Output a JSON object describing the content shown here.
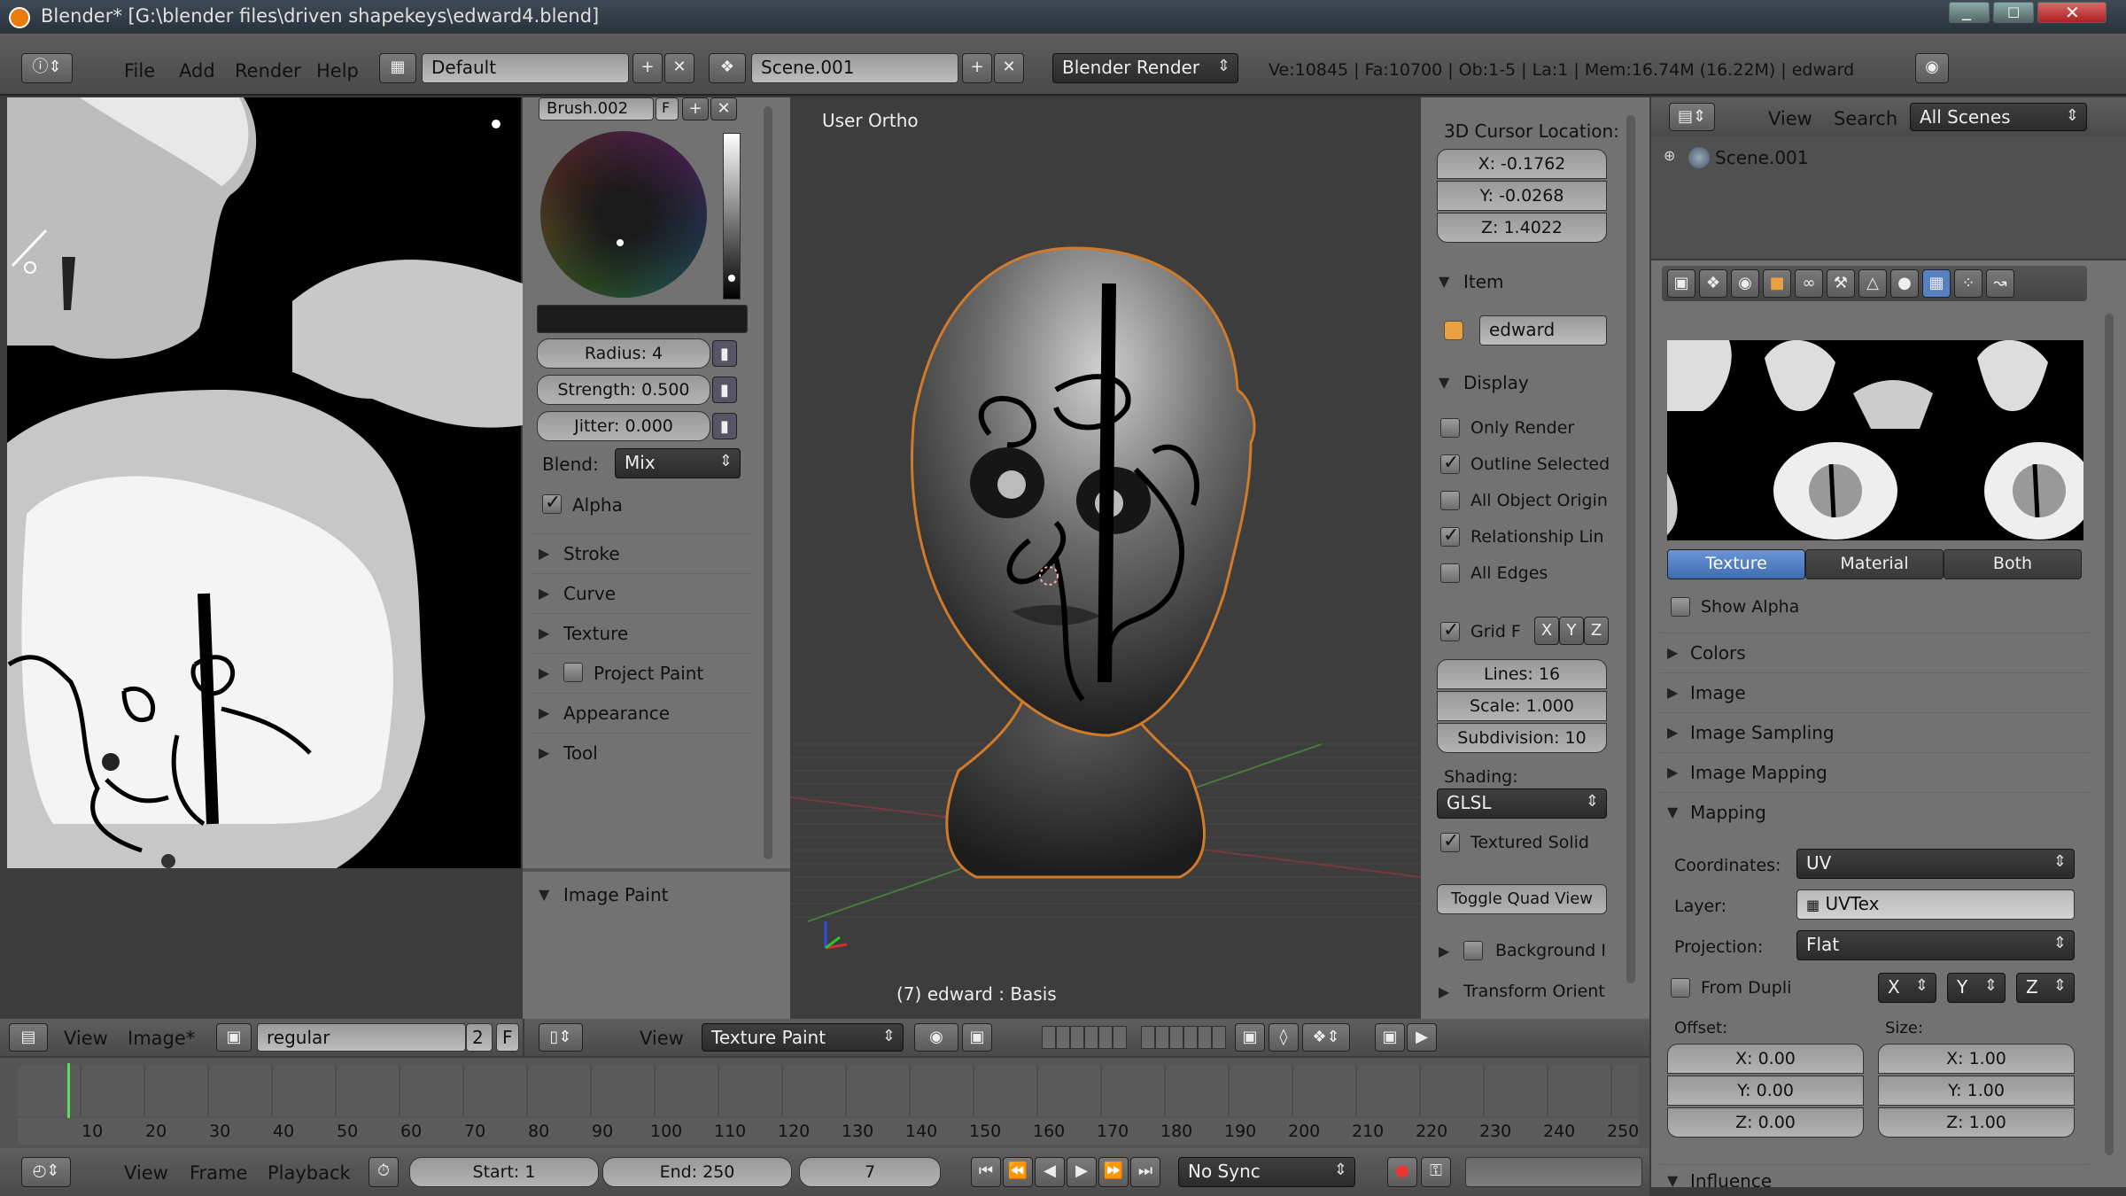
{
  "window": {
    "title": "Blender* [G:\\blender files\\driven shapekeys\\edward4.blend]"
  },
  "info_header": {
    "menus": [
      "File",
      "Add",
      "Render",
      "Help"
    ],
    "screen_layout": "Default",
    "scene": "Scene.001",
    "render_engine": "Blender Render",
    "stats": "Ve:10845 | Fa:10700 | Ob:1-5 | La:1 | Mem:16.74M (16.22M) | edward"
  },
  "image_editor": {
    "menus": [
      "View",
      "Image*"
    ],
    "image_name": "regular",
    "users": "2",
    "pin": "F"
  },
  "brush_panel": {
    "brush_name": "Brush.002",
    "brush_users": "F",
    "radius": "Radius: 4",
    "strength": "Strength: 0.500",
    "jitter": "Jitter: 0.000",
    "blend_label": "Blend:",
    "blend_value": "Mix",
    "alpha_label": "Alpha",
    "sections": [
      "Stroke",
      "Curve",
      "Texture",
      "Project Paint",
      "Appearance",
      "Tool"
    ],
    "image_paint": "Image Paint"
  },
  "viewport": {
    "view_label": "User Ortho",
    "object_label": "(7) edward : Basis",
    "header_menus": [
      "View"
    ],
    "mode": "Texture Paint"
  },
  "n_panel": {
    "cursor_title": "3D Cursor Location:",
    "cursor_x": "X: -0.1762",
    "cursor_y": "Y: -0.0268",
    "cursor_z": "Z: 1.4022",
    "item_title": "Item",
    "item_name": "edward",
    "display_title": "Display",
    "only_render": "Only Render",
    "outline_selected": "Outline Selected",
    "all_object_origin": "All Object Origin",
    "relationship_lines": "Relationship Lin",
    "all_edges": "All Edges",
    "grid_floor": "Grid F",
    "grid_axes": [
      "X",
      "Y",
      "Z"
    ],
    "lines": "Lines: 16",
    "scale": "Scale: 1.000",
    "subdivisions": "Subdivision: 10",
    "shading_label": "Shading:",
    "shading_value": "GLSL",
    "textured_solid": "Textured Solid",
    "toggle_quad": "Toggle Quad View",
    "background": "Background I",
    "transform_orient": "Transform Orient"
  },
  "outliner": {
    "menus": [
      "View",
      "Search"
    ],
    "filter": "All Scenes",
    "scene_item": "Scene.001"
  },
  "properties": {
    "preview_tabs": [
      "Texture",
      "Material",
      "Both"
    ],
    "show_alpha": "Show Alpha",
    "sections_collapsed": [
      "Colors",
      "Image",
      "Image Sampling",
      "Image Mapping"
    ],
    "mapping_title": "Mapping",
    "coordinates_label": "Coordinates:",
    "coordinates_value": "UV",
    "layer_label": "Layer:",
    "layer_value": "UVTex",
    "projection_label": "Projection:",
    "projection_value": "Flat",
    "from_dupli": "From Dupli",
    "proj_axes": [
      "X",
      "Y",
      "Z"
    ],
    "offset_label": "Offset:",
    "size_label": "Size:",
    "offset_x": "X: 0.00",
    "offset_y": "Y: 0.00",
    "offset_z": "Z: 0.00",
    "size_x": "X: 1.00",
    "size_y": "Y: 1.00",
    "size_z": "Z: 1.00",
    "influence": "Influence"
  },
  "timeline": {
    "ticks": [
      "10",
      "20",
      "30",
      "40",
      "50",
      "60",
      "70",
      "80",
      "90",
      "100",
      "110",
      "120",
      "130",
      "140",
      "150",
      "160",
      "170",
      "180",
      "190",
      "200",
      "210",
      "220",
      "230",
      "240",
      "250"
    ],
    "menus": [
      "View",
      "Frame",
      "Playback"
    ],
    "start": "Start: 1",
    "end": "End: 250",
    "current": "7",
    "sync": "No Sync"
  }
}
